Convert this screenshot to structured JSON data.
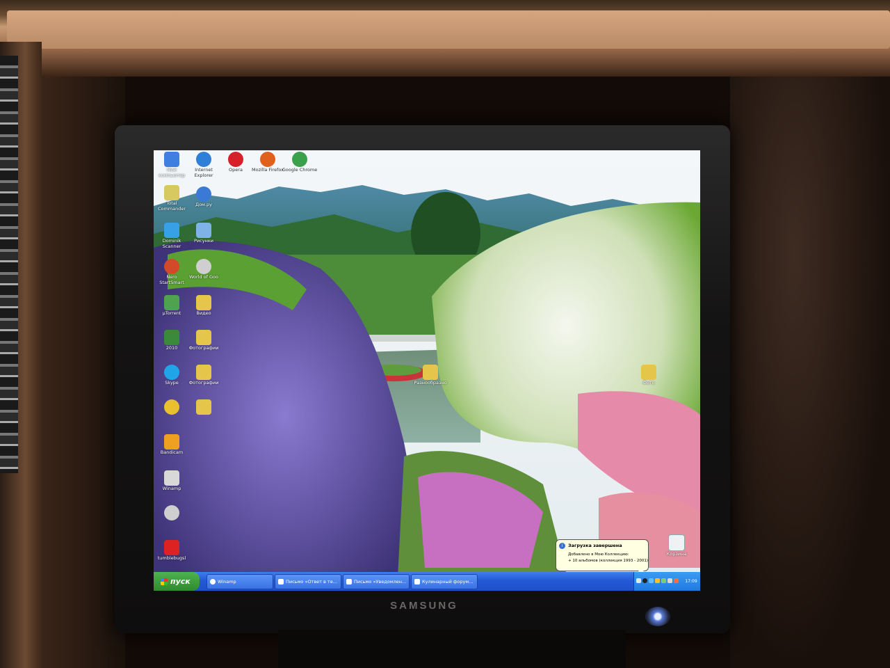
{
  "desktop_icons": [
    {
      "label": "Мой компьютер",
      "color": "#3f7fe0"
    },
    {
      "label": "Total Commander",
      "color": "#d7c860"
    },
    {
      "label": "Dominik Scanner",
      "color": "#38a0e6"
    },
    {
      "label": "Nero StartSmart",
      "color": "#d24a2a"
    },
    {
      "label": "µTorrent",
      "color": "#4fa34f"
    },
    {
      "label": "2010",
      "color": "#3b8a3b"
    },
    {
      "label": "Skype",
      "color": "#21a4e8"
    },
    {
      "label": "",
      "color": "#e8c030"
    },
    {
      "label": "Bandicam",
      "color": "#f0a020"
    },
    {
      "label": "Winamp",
      "color": "#d8d8d8"
    },
    {
      "label": "",
      "color": "#cfcfcf"
    },
    {
      "label": "tumblebugsl",
      "color": "#d22"
    }
  ],
  "top_icons": [
    {
      "label": "Internet Explorer",
      "color": "#2f7fd6"
    },
    {
      "label": "Opera",
      "color": "#d6202a"
    },
    {
      "label": "Mozilla Firefox",
      "color": "#e0601e"
    },
    {
      "label": "Google Chrome",
      "color": "#3aa04a"
    }
  ],
  "second_col_icons": [
    {
      "label": "Дом.ру",
      "color": "#3a7ad6"
    },
    {
      "label": "Рисунки",
      "color": "#7fb2e6"
    },
    {
      "label": "World of Goo",
      "color": "#cfcfcf"
    },
    {
      "label": "Видео",
      "color": "#e6c64a"
    },
    {
      "label": "Фотографии",
      "color": "#e6c64a"
    },
    {
      "label": "Фотографии",
      "color": "#e6c64a"
    },
    {
      "label": "",
      "color": "#e6c64a"
    }
  ],
  "loose_icons": [
    {
      "label": "Разнообразно",
      "color": "#e6c64a"
    },
    {
      "label": "Фото",
      "color": "#e6c64a"
    }
  ],
  "recycle_bin": {
    "label": "Корзина"
  },
  "taskbar": {
    "start_label": "пуск",
    "tasks": [
      {
        "label": "Winamp"
      },
      {
        "label": "Письмо «Ответ в те..."
      },
      {
        "label": "Письмо «Уведомлен..."
      },
      {
        "label": "Кулинарный форум..."
      }
    ],
    "clock": "17:09"
  },
  "notification": {
    "title": "Загрузка завершена",
    "line1": "Добавлено в Мою Коллекцию:",
    "line2": "+ 10 альбомов (коллекция 1993 - 2001)"
  },
  "monitor": {
    "brand": "SAMSUNG"
  }
}
